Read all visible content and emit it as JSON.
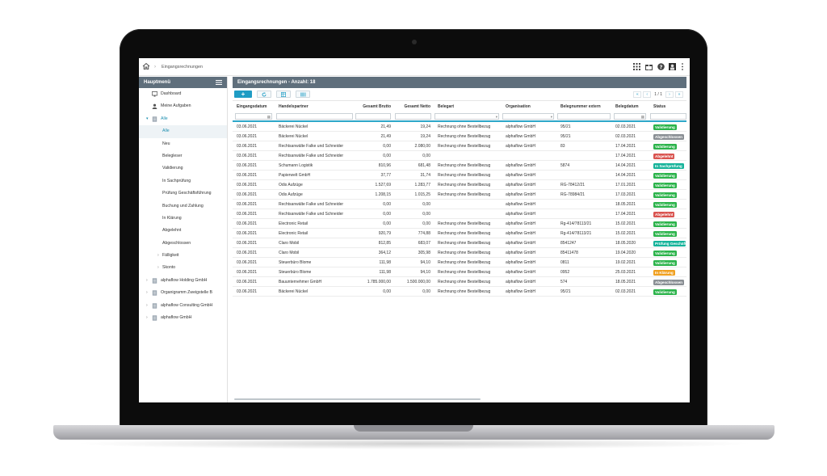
{
  "app": {
    "breadcrumb": "Eingangsrechnungen"
  },
  "sidebar": {
    "title": "Hauptmenü",
    "items": [
      {
        "label": "Dashboard",
        "level": 0,
        "icon": "monitor-icon"
      },
      {
        "label": "Meine Aufgaben",
        "level": 0,
        "icon": "user-icon"
      },
      {
        "label": "Alle",
        "level": 0,
        "icon": "folder-icon",
        "expanded": true
      },
      {
        "label": "Alle",
        "level": 1,
        "selected": true
      },
      {
        "label": "Neu",
        "level": 1
      },
      {
        "label": "Belegleser",
        "level": 1
      },
      {
        "label": "Validierung",
        "level": 1
      },
      {
        "label": "In Sachprüfung",
        "level": 1
      },
      {
        "label": "Prüfung Geschäftsführung",
        "level": 1
      },
      {
        "label": "Buchung und Zahlung",
        "level": 1
      },
      {
        "label": "In Klärung",
        "level": 1
      },
      {
        "label": "Abgelehnt",
        "level": 1
      },
      {
        "label": "Abgeschlossen",
        "level": 1
      },
      {
        "label": "Fälligkeit",
        "level": 1,
        "collapsible": true
      },
      {
        "label": "Skonto",
        "level": 1,
        "collapsible": true
      },
      {
        "label": "alphaflow Holding GmbH",
        "level": 0,
        "icon": "folder-icon",
        "collapsible": true
      },
      {
        "label": "Organigramm Zweigstelle B",
        "level": 0,
        "icon": "folder-icon",
        "collapsible": true
      },
      {
        "label": "alphaflow Consulting GmbH",
        "level": 0,
        "icon": "folder-icon",
        "collapsible": true
      },
      {
        "label": "alphaflow GmbH",
        "level": 0,
        "icon": "folder-icon",
        "collapsible": true
      }
    ]
  },
  "main": {
    "title": "Eingangsrechnungen - Anzahl: 18",
    "toolbar": {
      "add_label": "+",
      "pager_info": "1 / 1"
    },
    "columns": [
      "Eingangsdatum",
      "Handelspartner",
      "Gesamt Brutto",
      "Gesamt Netto",
      "Belegart",
      "Organisation",
      "Belegnummer extern",
      "Belegdatum",
      "Status"
    ],
    "rows": [
      [
        "03.06.2021",
        "Bäckerei Nückel",
        "21,49",
        "19,24",
        "Rechnung ohne Bestellbezug",
        "alphaflow GmbH",
        "95/21",
        "02.03.2021",
        "Validierung"
      ],
      [
        "03.06.2021",
        "Bäckerei Nückel",
        "21,49",
        "19,24",
        "Rechnung ohne Bestellbezug",
        "alphaflow GmbH",
        "95/21",
        "02.03.2021",
        "Abgeschlossen"
      ],
      [
        "03.06.2021",
        "Rechtsanwälte Falke und Schneider",
        "0,00",
        "2.080,00",
        "Rechnung ohne Bestellbezug",
        "alphaflow GmbH",
        "83",
        "17.04.2021",
        "Validierung"
      ],
      [
        "03.06.2021",
        "Rechtsanwälte Falke und Schneider",
        "0,00",
        "0,00",
        "",
        "",
        "",
        "17.04.2021",
        "Abgelehnt"
      ],
      [
        "03.06.2021",
        "Schumann Logistik",
        "810,96",
        "681,48",
        "Rechnung ohne Bestellbezug",
        "alphaflow GmbH",
        "5874",
        "14.04.2021",
        "In Sachprüfung"
      ],
      [
        "03.06.2021",
        "Papierwelt GmbH",
        "37,77",
        "31,74",
        "Rechnung ohne Bestellbezug",
        "alphaflow GmbH",
        "",
        "14.04.2021",
        "Validierung"
      ],
      [
        "03.06.2021",
        "Odis Aufzüge",
        "1.527,69",
        "1.283,77",
        "Rechnung ohne Bestellbezug",
        "alphaflow GmbH",
        "RG-78412/21",
        "17.01.2021",
        "Validierung"
      ],
      [
        "03.06.2021",
        "Odis Aufzüge",
        "1.208,15",
        "1.015,25",
        "Rechnung ohne Bestellbezug",
        "alphaflow GmbH",
        "RG-78984/21",
        "17.03.2021",
        "Validierung"
      ],
      [
        "03.06.2021",
        "Rechtsanwälte Falke und Schneider",
        "0,00",
        "0,00",
        "",
        "alphaflow GmbH",
        "",
        "18.05.2021",
        "Validierung"
      ],
      [
        "03.06.2021",
        "Rechtsanwälte Falke und Schneider",
        "0,00",
        "0,00",
        "",
        "alphaflow GmbH",
        "",
        "17.04.2021",
        "Abgelehnt"
      ],
      [
        "03.06.2021",
        "Electronic Retail",
        "0,00",
        "0,00",
        "Rechnung ohne Bestellbezug",
        "alphaflow GmbH",
        "Rg-414/78113/21",
        "15.02.2021",
        "Validierung"
      ],
      [
        "03.06.2021",
        "Electronic Retail",
        "920,79",
        "774,88",
        "Rechnung ohne Bestellbezug",
        "alphaflow GmbH",
        "Rg-414/78113/21",
        "15.02.2021",
        "Validierung"
      ],
      [
        "03.06.2021",
        "Claro Mobil",
        "812,85",
        "683,07",
        "Rechnung ohne Bestellbezug",
        "alphaflow GmbH",
        "8541247",
        "18.05.2020",
        "Prüfung Geschäftsführung"
      ],
      [
        "03.06.2021",
        "Claro Mobil",
        "364,12",
        "305,98",
        "Rechnung ohne Bestellbezug",
        "alphaflow GmbH",
        "85411478",
        "19.04.2020",
        "Validierung"
      ],
      [
        "03.06.2021",
        "Steuerbüro Blome",
        "111,98",
        "94,10",
        "Rechnung ohne Bestellbezug",
        "alphaflow GmbH",
        "0811",
        "19.02.2021",
        "Validierung"
      ],
      [
        "03.06.2021",
        "Steuerbüro Blome",
        "111,98",
        "94,10",
        "Rechnung ohne Bestellbezug",
        "alphaflow GmbH",
        "0952",
        "25.03.2021",
        "In Klärung"
      ],
      [
        "03.06.2021",
        "Bauunternehmer GmbH",
        "1.785.000,00",
        "1.500.000,00",
        "Rechnung ohne Bestellbezug",
        "alphaflow GmbH",
        "574",
        "18.05.2021",
        "Abgeschlossen"
      ],
      [
        "03.06.2021",
        "Bäckerei Nückel",
        "0,00",
        "0,00",
        "Rechnung ohne Bestellbezug",
        "alphaflow GmbH",
        "95/21",
        "02.03.2021",
        "Validierung"
      ]
    ]
  },
  "colors": {
    "header": "#5f6f7c",
    "accent": "#1f9cc4",
    "status_validierung": "#2bb34a",
    "status_abgeschlossen": "#8a8f94",
    "status_abgelehnt": "#d9534f",
    "status_sachpruefung": "#16b39a",
    "status_klaerung": "#f0a020"
  }
}
